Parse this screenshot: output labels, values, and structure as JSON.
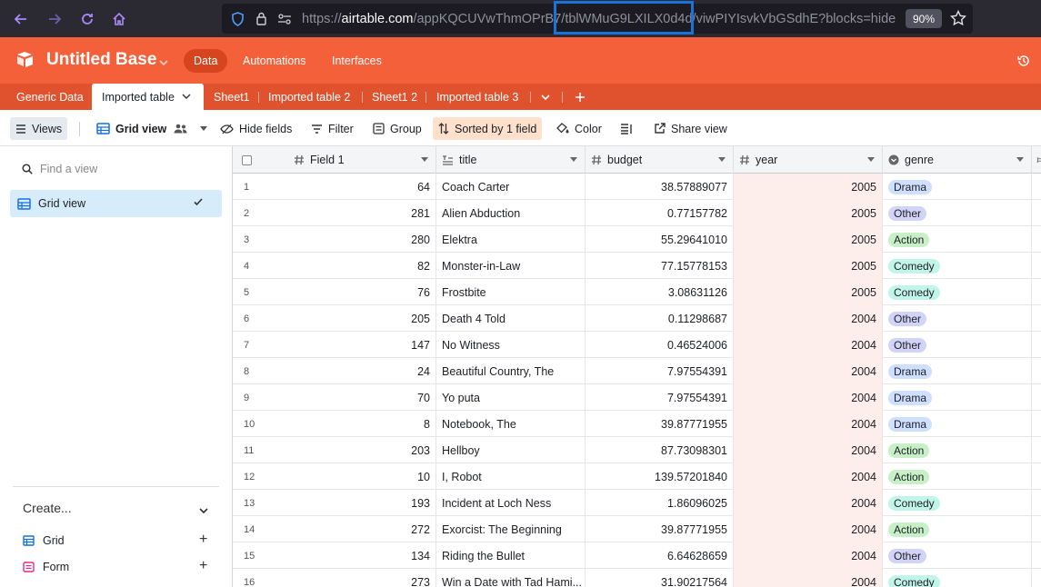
{
  "browser": {
    "url_scheme": "https://",
    "url_host": "airtable.com",
    "url_path": "/appKQCUVwThmOPrB7/tblWMuG9LXILX0d4d/viwPIYIsvkVbGSdhE?blocks=hide",
    "zoom": "90%"
  },
  "app": {
    "base_name": "Untitled Base",
    "nav": [
      "Data",
      "Automations",
      "Interfaces"
    ],
    "brand_color": "#f4603a"
  },
  "tabs": [
    "Generic Data",
    "Imported table",
    "Sheet1",
    "Imported table 2",
    "Sheet1 2",
    "Imported table 3"
  ],
  "toolbar": {
    "views": "Views",
    "grid_view": "Grid view",
    "hide_fields": "Hide fields",
    "filter": "Filter",
    "group": "Group",
    "sorted": "Sorted by 1 field",
    "color": "Color",
    "share": "Share view"
  },
  "sidebar": {
    "find_placeholder": "Find a view",
    "view_name": "Grid view",
    "create_label": "Create...",
    "create_items": [
      "Grid",
      "Form"
    ]
  },
  "grid": {
    "columns": [
      "Field 1",
      "title",
      "budget",
      "year",
      "genre"
    ],
    "rows": [
      {
        "n": "1",
        "field1": "64",
        "title": "Coach Carter",
        "budget": "38.57889077",
        "year": "2005",
        "genre": "Drama"
      },
      {
        "n": "2",
        "field1": "281",
        "title": "Alien Abduction",
        "budget": "0.77157782",
        "year": "2005",
        "genre": "Other"
      },
      {
        "n": "3",
        "field1": "280",
        "title": "Elektra",
        "budget": "55.29641010",
        "year": "2005",
        "genre": "Action"
      },
      {
        "n": "4",
        "field1": "82",
        "title": "Monster-in-Law",
        "budget": "77.15778153",
        "year": "2005",
        "genre": "Comedy"
      },
      {
        "n": "5",
        "field1": "76",
        "title": "Frostbite",
        "budget": "3.08631126",
        "year": "2005",
        "genre": "Comedy"
      },
      {
        "n": "6",
        "field1": "205",
        "title": "Death 4 Told",
        "budget": "0.11298687",
        "year": "2004",
        "genre": "Other"
      },
      {
        "n": "7",
        "field1": "147",
        "title": "No Witness",
        "budget": "0.46524006",
        "year": "2004",
        "genre": "Other"
      },
      {
        "n": "8",
        "field1": "24",
        "title": "Beautiful Country, The",
        "budget": "7.97554391",
        "year": "2004",
        "genre": "Drama"
      },
      {
        "n": "9",
        "field1": "70",
        "title": "Yo puta",
        "budget": "7.97554391",
        "year": "2004",
        "genre": "Drama"
      },
      {
        "n": "10",
        "field1": "8",
        "title": "Notebook, The",
        "budget": "39.87771955",
        "year": "2004",
        "genre": "Drama"
      },
      {
        "n": "11",
        "field1": "203",
        "title": "Hellboy",
        "budget": "87.73098301",
        "year": "2004",
        "genre": "Action"
      },
      {
        "n": "12",
        "field1": "10",
        "title": "I, Robot",
        "budget": "139.57201840",
        "year": "2004",
        "genre": "Action"
      },
      {
        "n": "13",
        "field1": "193",
        "title": "Incident at Loch Ness",
        "budget": "1.86096025",
        "year": "2004",
        "genre": "Comedy"
      },
      {
        "n": "14",
        "field1": "272",
        "title": "Exorcist: The Beginning",
        "budget": "39.87771955",
        "year": "2004",
        "genre": "Action"
      },
      {
        "n": "15",
        "field1": "134",
        "title": "Riding the Bullet",
        "budget": "6.64628659",
        "year": "2004",
        "genre": "Other"
      },
      {
        "n": "16",
        "field1": "273",
        "title": "Win a Date with Tad Hami...",
        "budget": "31.90217564",
        "year": "2004",
        "genre": "Comedy"
      }
    ],
    "genre_colors": {
      "Drama": "#cfdfff",
      "Other": "#d1d4f7",
      "Action": "#c7f0c7",
      "Comedy": "#c2f5e9"
    }
  }
}
